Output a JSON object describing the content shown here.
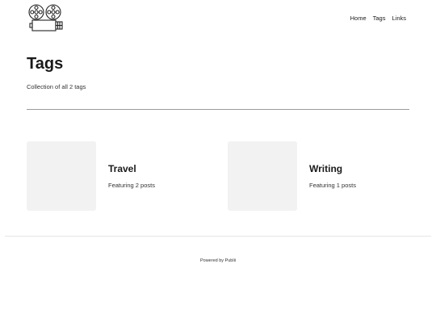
{
  "header": {
    "logo_icon": "film-projector-icon",
    "nav": [
      {
        "label": "Home"
      },
      {
        "label": "Tags"
      },
      {
        "label": "Links"
      }
    ]
  },
  "main": {
    "title": "Tags",
    "subtitle": "Collection of all 2 tags",
    "tags": [
      {
        "name": "Travel",
        "count_text": "Featuring 2 posts"
      },
      {
        "name": "Writing",
        "count_text": "Featuring 1 posts"
      }
    ]
  },
  "footer": {
    "powered_prefix": "Powered by ",
    "powered_link": "Publii"
  },
  "colors": {
    "background": "#ffffff",
    "thumbnail": "#f2f2f2",
    "divider": "#9a9a9a",
    "text": "#1a1a1a"
  }
}
